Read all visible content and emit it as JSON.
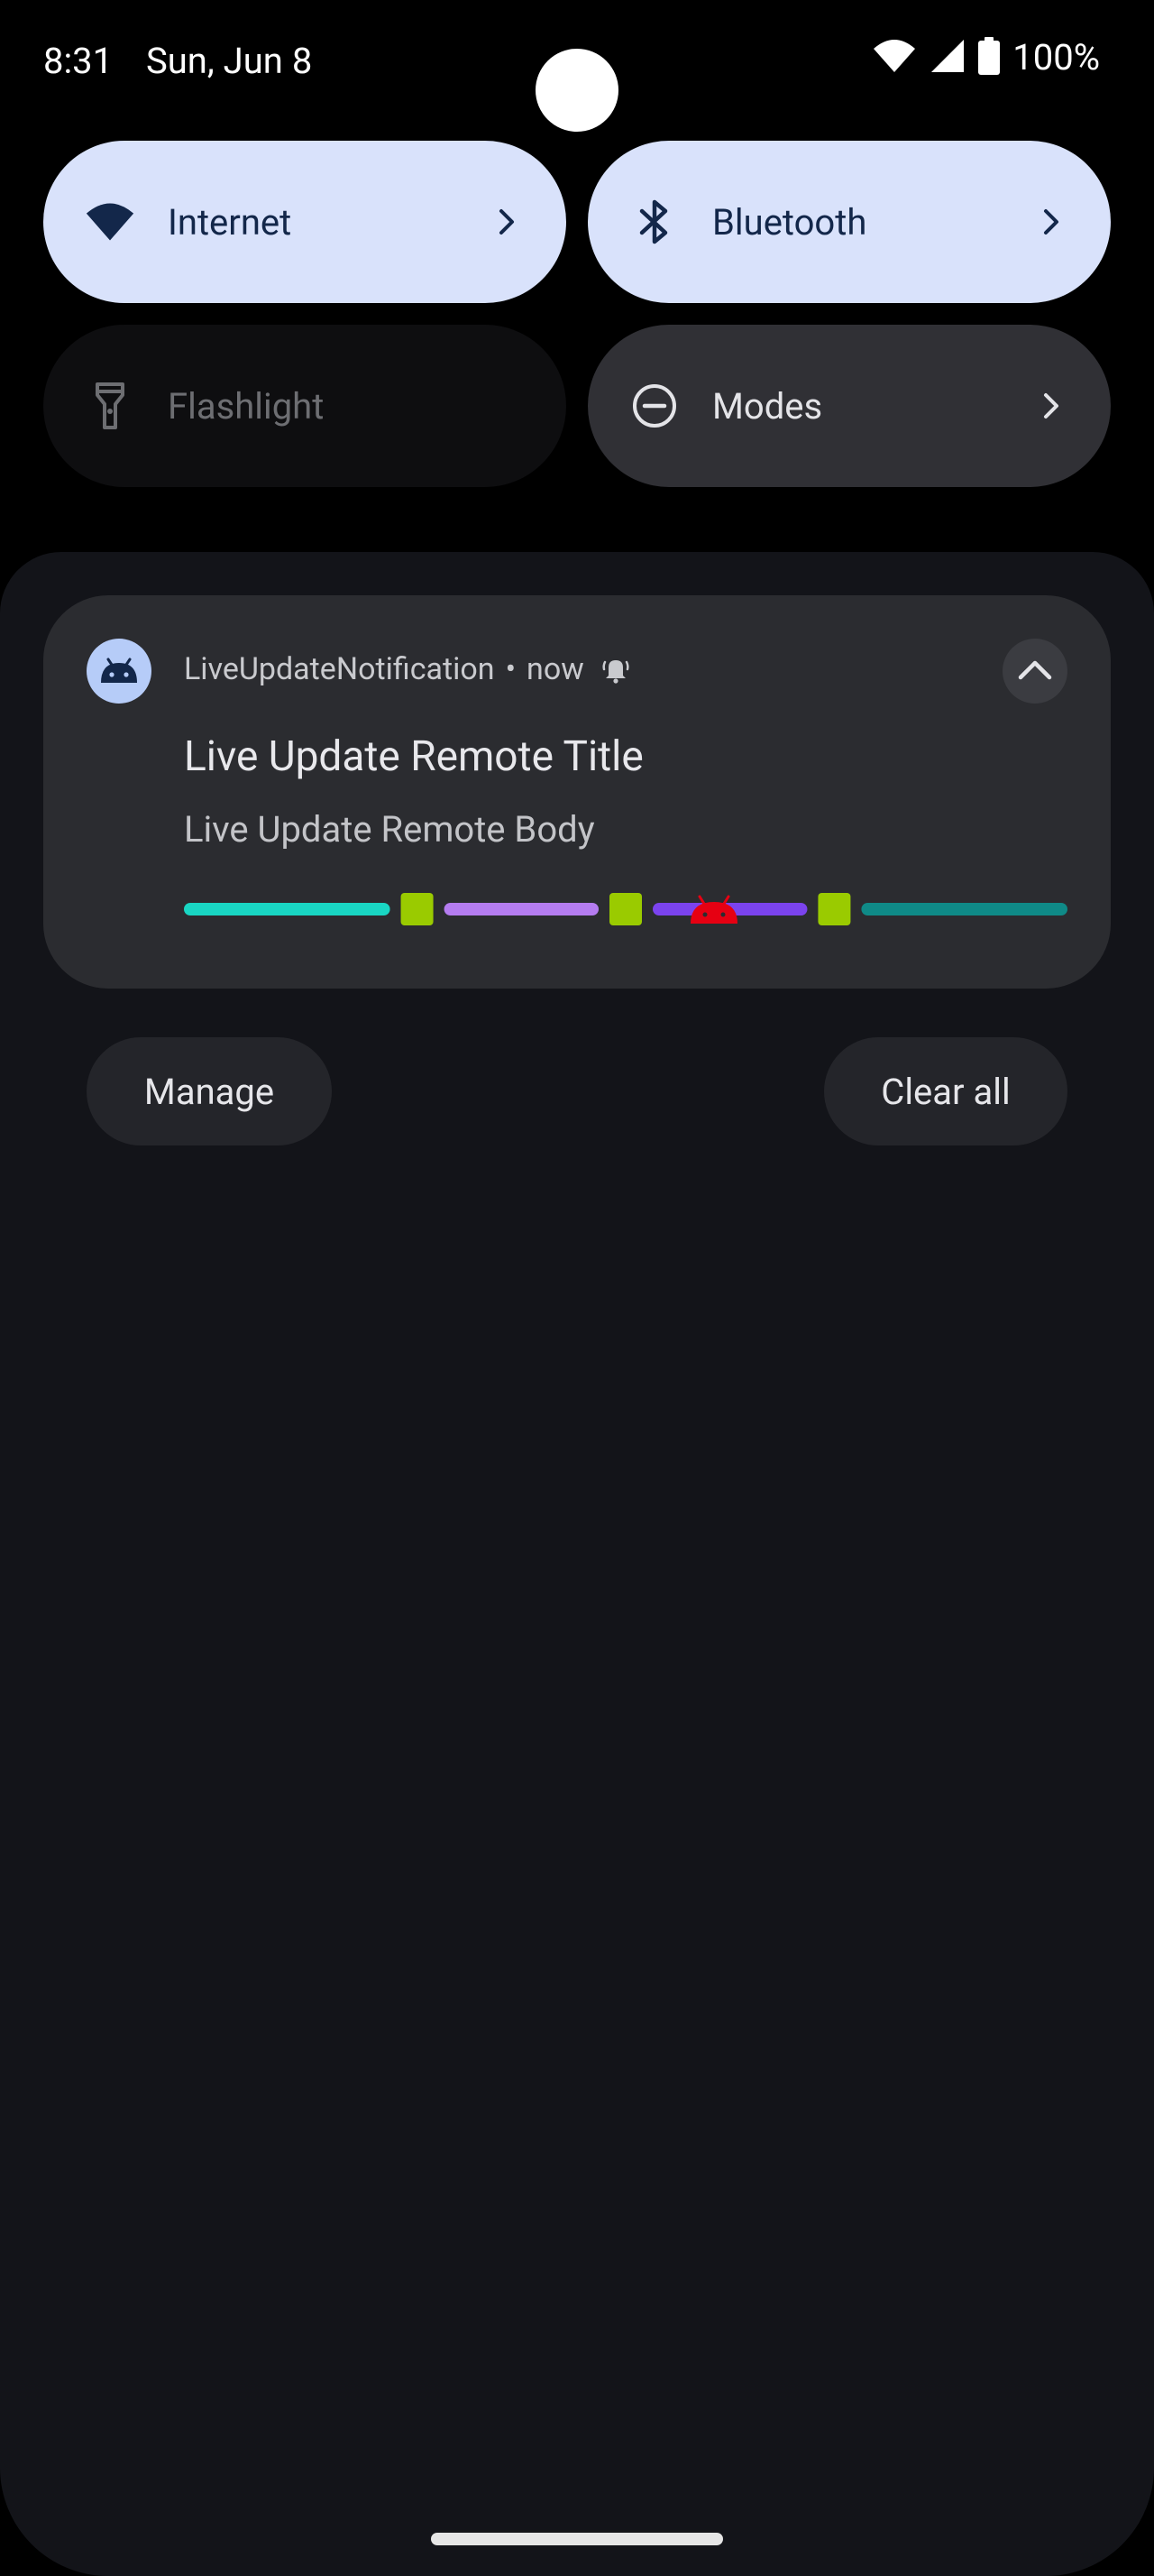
{
  "status_bar": {
    "time": "8:31",
    "date": "Sun, Jun 8",
    "battery": "100%"
  },
  "quick_settings": [
    {
      "label": "Internet",
      "icon": "wifi-icon",
      "state": "active",
      "has_chevron": true
    },
    {
      "label": "Bluetooth",
      "icon": "bluetooth-icon",
      "state": "active",
      "has_chevron": true
    },
    {
      "label": "Flashlight",
      "icon": "flashlight-icon",
      "state": "off",
      "has_chevron": false
    },
    {
      "label": "Modes",
      "icon": "do-not-disturb-icon",
      "state": "neutral",
      "has_chevron": true
    }
  ],
  "notification": {
    "app_name": "LiveUpdateNotification",
    "separator": "•",
    "time": "now",
    "title": "Live Update Remote Title",
    "body": "Live Update Remote Body",
    "progress": {
      "segments": [
        {
          "color": "#19d6c3",
          "fraction": 0.24
        },
        {
          "color": "#b57cf0",
          "fraction": 0.18
        },
        {
          "color": "#7b43ee",
          "fraction": 0.18
        },
        {
          "color": "#0f8a87",
          "fraction": 0.24
        }
      ],
      "point_color": "#9acb00",
      "tracker_color": "#e60012",
      "tracker_position": 0.6
    }
  },
  "actions": {
    "manage": "Manage",
    "clear_all": "Clear all"
  },
  "colors": {
    "tile_active": "#d9e2fb",
    "shade": "#131419",
    "card": "#2b2c30"
  }
}
